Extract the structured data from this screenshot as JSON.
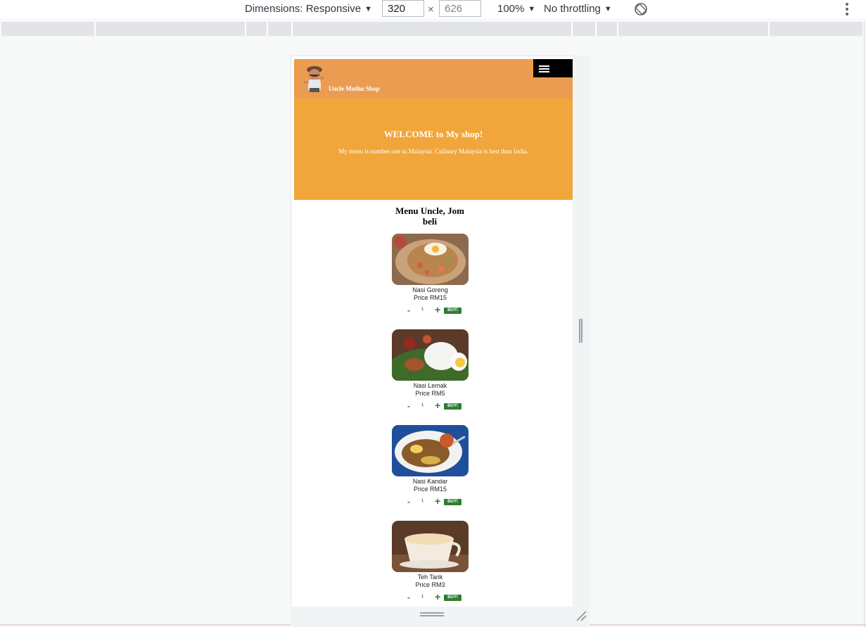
{
  "devtools": {
    "dimensions_label": "Dimensions: Responsive",
    "width_value": "320",
    "height_value": "626",
    "times_symbol": "×",
    "zoom_label": "100%",
    "throttling_label": "No throttling",
    "caret": "▼"
  },
  "site": {
    "shop_name": "Uncle Muthu Shop",
    "hero_title": "WELCOME to My shop!",
    "hero_subtitle": "My menu is number one in Malaysia. Culinary Malaysia is best than India.",
    "menu_title": "Menu Uncle, Jom beli",
    "colors": {
      "header": "#ec9c50",
      "hero": "#f0a63a",
      "buy_button": "#2e7d32"
    },
    "items": [
      {
        "name": "Nasi Goreng",
        "price": "Price RM15",
        "qty": "1",
        "minus": "-",
        "plus": "+",
        "buy": "BUY!"
      },
      {
        "name": "Nasi Lemak",
        "price": "Price RM5",
        "qty": "1",
        "minus": "-",
        "plus": "+",
        "buy": "BUY!"
      },
      {
        "name": "Nasi Kandar",
        "price": "Price RM15",
        "qty": "1",
        "minus": "-",
        "plus": "+",
        "buy": "BUY!"
      },
      {
        "name": "Teh Tarik",
        "price": "Price RM3",
        "qty": "1",
        "minus": "-",
        "plus": "+",
        "buy": "BUY!"
      }
    ]
  }
}
